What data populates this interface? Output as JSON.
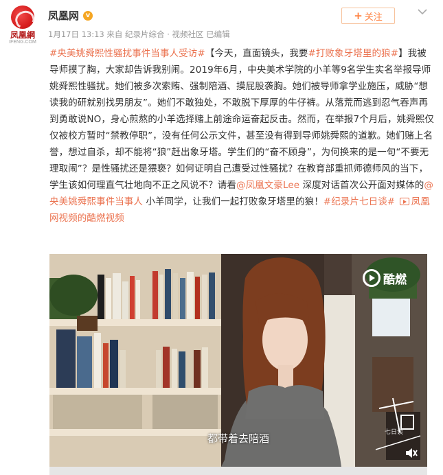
{
  "account": {
    "logo_text": "凤凰網",
    "logo_sub": "IFENG.COM",
    "name": "凤凰网",
    "verified_mark": "v",
    "meta": "1月17日 13:13 来自 纪录片综合 · 视频社区   已编辑"
  },
  "follow_button": {
    "plus": "+",
    "label": "关注"
  },
  "post": {
    "seg1": "#央美姚舜熙性骚扰事件当事人受访#",
    "seg2": "【今天，直面镜头，我要",
    "seg3": "#打败象牙塔里的狼#",
    "seg4": "】我被导师摸了胸，大家却告诉我别闹。2019年6月，中央美术学院的小羊等9名学生实名举报导师姚舜熙性骚扰。她们被多次索贿、强制陪酒、摸屁股袭胸。她们被导师拿学业施压，威胁“想读我的研就别找男朋友”。她们不敢独处，不敢脱下厚厚的牛仔裤。从落荒而逃到忍气吞声再到勇敢说NO，身心煎熬的小羊选择赌上前途命运奋起反击。然而，在举报7个月后，姚舜熙仅仅被校方暂时“禁教停职”，没有任何公示文件，甚至没有得到导师姚舜熙的道歉。她们赌上名誉，想过自杀，却不能将“狼”赶出象牙塔。学生们的“奋不顾身”，为何换来的是一句“不要无理取闹”？是性骚扰还是猥亵？如何证明自己遭受过性骚扰？在教育部重抓师德师风的当下，学生该如何理直气壮地向不正之风说不？请看",
    "seg5": "@凤凰文豪Lee",
    "seg6": " 深度对话首次公开面对媒体的",
    "seg7": "@央美姚舜熙事件当事人",
    "seg8": " 小羊同学，让我们一起打败象牙塔里的狼！",
    "seg9": "#纪录片七日谈#",
    "seg10": "凤凰网视频的酷燃视频"
  },
  "video": {
    "watermark": "酷燃",
    "subtitle": "都带着去陪酒",
    "side_mark": "七日谈"
  },
  "colors": {
    "link": "#eb7350",
    "follow": "#ff8140",
    "meta": "#999999"
  }
}
